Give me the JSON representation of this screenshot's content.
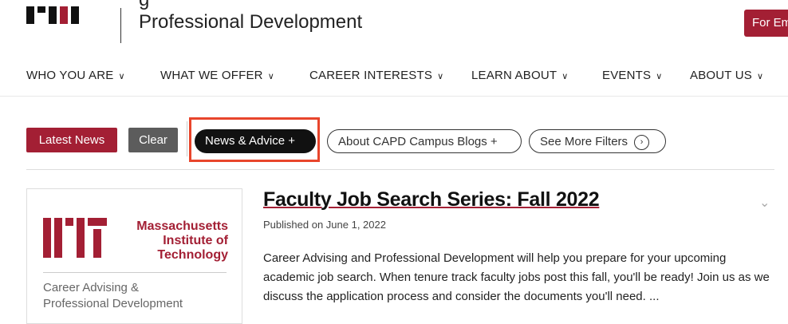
{
  "header": {
    "dept_top_fragment": "g",
    "dept_title": "Professional Development",
    "for_button": "For Em"
  },
  "nav": {
    "items": [
      {
        "label": "WHO YOU ARE"
      },
      {
        "label": "WHAT WE OFFER"
      },
      {
        "label": "CAREER INTERESTS"
      },
      {
        "label": "LEARN ABOUT"
      },
      {
        "label": "EVENTS"
      },
      {
        "label": "ABOUT US"
      }
    ],
    "chevron": "∨"
  },
  "filters": {
    "latest_news": "Latest News",
    "clear": "Clear",
    "news_advice": "News & Advice +",
    "blogs": "About CAPD Campus Blogs +",
    "see_more": "See More Filters",
    "see_more_icon": "›"
  },
  "card": {
    "mit_name_1": "Massachusetts",
    "mit_name_2": "Institute of",
    "mit_name_3": "Technology",
    "sub_1": "Career Advising &",
    "sub_2": "Professional Development"
  },
  "article": {
    "title": "Faculty Job Search Series: Fall 2022",
    "date": "Published on June 1, 2022",
    "body": "Career Advising and Professional Development will help you prepare for your upcoming academic job search. When tenure track faculty jobs post this fall, you'll be ready! Join us as we discuss the application process and consider the documents you'll need. ...",
    "expand_icon": "⌄"
  },
  "colors": {
    "brand_red": "#a31f34",
    "highlight": "#e8452c"
  }
}
